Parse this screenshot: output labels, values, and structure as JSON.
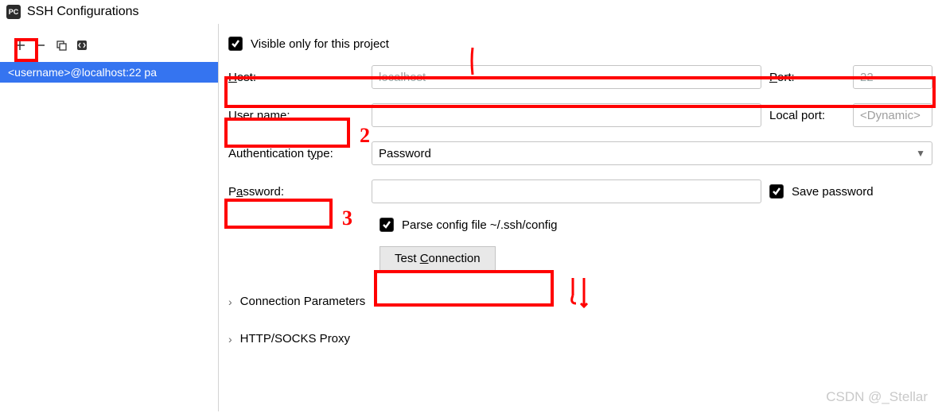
{
  "window": {
    "title": "SSH Configurations"
  },
  "sidebar": {
    "items": [
      {
        "label": "<username>@localhost:22 pa",
        "selected": true
      }
    ]
  },
  "form": {
    "visible_only_label": "Visible only for this project",
    "host_label": "Host:",
    "host_placeholder": "localhost",
    "port_label": "Port:",
    "port_placeholder": "22",
    "user_label": "User name:",
    "localport_label": "Local port:",
    "localport_placeholder": "<Dynamic>",
    "auth_label": "Authentication type:",
    "auth_value": "Password",
    "password_label": "Password:",
    "savepw_label": "Save password",
    "parse_label": "Parse config file ~/.ssh/config",
    "test_btn": "Test Connection",
    "section_conn": "Connection Parameters",
    "section_proxy": "HTTP/SOCKS Proxy"
  },
  "annotations": {
    "a1": "1",
    "a2": "2",
    "a3": "3",
    "a4": "4"
  },
  "watermark": "CSDN @_Stellar"
}
